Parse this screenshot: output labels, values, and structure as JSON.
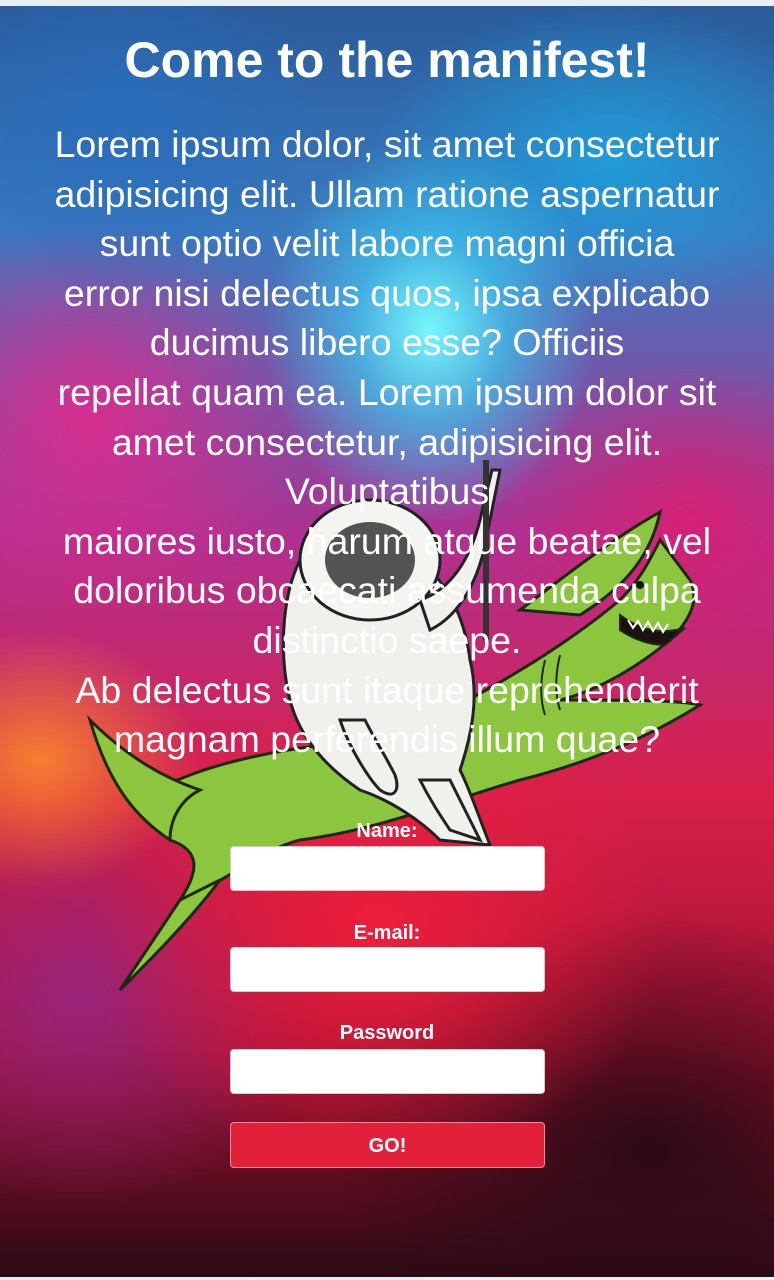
{
  "page": {
    "heading": "Come to the manifest!",
    "intro_text": "Lorem ipsum dolor, sit amet consectetur adipisicing elit. Ullam ratione aspernatur sunt optio velit labore magni officia error nisi delectus quos, ipsa explicabo ducimus libero esse? Officiis repellat quam ea. Lorem ipsum dolor sit amet consectetur, adipisicing elit. Voluptatibus maiores iusto, harum atque beatae, vel doloribus obcaecati assumenda culpa distinctio saepe. Ab delectus sunt itaque reprehenderit magnam perferendis illum quae?",
    "intro_lines": [
      "Lorem ipsum dolor, sit amet consectetur",
      "adipisicing elit. Ullam ratione aspernatur",
      "sunt optio velit labore magni officia",
      "error nisi delectus quos, ipsa explicabo",
      "ducimus libero esse? Officiis",
      "repellat quam ea. Lorem ipsum dolor sit",
      "amet consectetur, adipisicing elit.",
      "Voluptatibus",
      "maiores iusto, harum atque beatae, vel",
      "doloribus obcaecati assumenda culpa",
      "distinctio saepe.",
      "Ab delectus sunt itaque reprehenderit",
      "magnam perferendis illum quae?"
    ]
  },
  "form": {
    "name_label": "Name:",
    "name_value": "",
    "email_label": "E-mail:",
    "email_value": "",
    "password_label": "Password",
    "password_value": "",
    "submit_label": "GO!"
  },
  "colors": {
    "button": "#e3203a",
    "text": "#ffffff"
  },
  "icons": {
    "background": "space-nebula-background",
    "illustration": "astronaut-riding-shark-illustration"
  }
}
